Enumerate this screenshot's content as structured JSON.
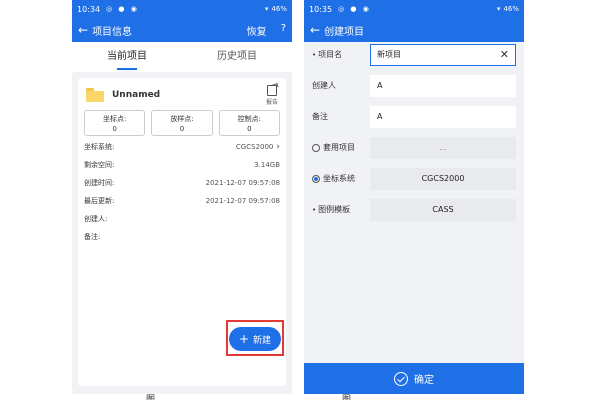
{
  "left": {
    "status": {
      "time": "10:34",
      "icons": "◎ ● ◉",
      "battery": "46%"
    },
    "appbar": {
      "title": "项目信息",
      "restore": "恢复",
      "help": "?"
    },
    "tabs": [
      {
        "label": "当前项目"
      },
      {
        "label": "历史项目"
      }
    ],
    "project": {
      "name": "Unnamed",
      "report": "报告"
    },
    "stats": [
      {
        "label": "坐标点:",
        "value": "0"
      },
      {
        "label": "放样点:",
        "value": "0"
      },
      {
        "label": "控制点:",
        "value": "0"
      }
    ],
    "info": [
      {
        "label": "坐标系统:",
        "value": "CGCS2000"
      },
      {
        "label": "剩余空间:",
        "value": "3.14GB"
      },
      {
        "label": "创建时间:",
        "value": "2021-12-07 09:57:08"
      },
      {
        "label": "最后更新:",
        "value": "2021-12-07 09:57:08"
      },
      {
        "label": "创建人:",
        "value": ""
      },
      {
        "label": "备注:",
        "value": ""
      }
    ],
    "fab": {
      "label": "新建"
    }
  },
  "right": {
    "status": {
      "time": "10:35",
      "icons": "◎ ● ◉",
      "battery": "46%"
    },
    "appbar": {
      "title": "创建项目"
    },
    "form": {
      "project_name": {
        "label": "项目名",
        "value": "新项目"
      },
      "creator": {
        "label": "创建人",
        "value": "A"
      },
      "remark": {
        "label": "备注",
        "value": "A"
      },
      "apply_project": {
        "label": "套用项目",
        "value": "..."
      },
      "coord_system": {
        "label": "坐标系统",
        "value": "CGCS2000"
      },
      "legend_template": {
        "label": "图例模板",
        "value": "CASS"
      }
    },
    "confirm": {
      "label": "确定"
    }
  },
  "captions": {
    "left": "图",
    "right": "图"
  }
}
